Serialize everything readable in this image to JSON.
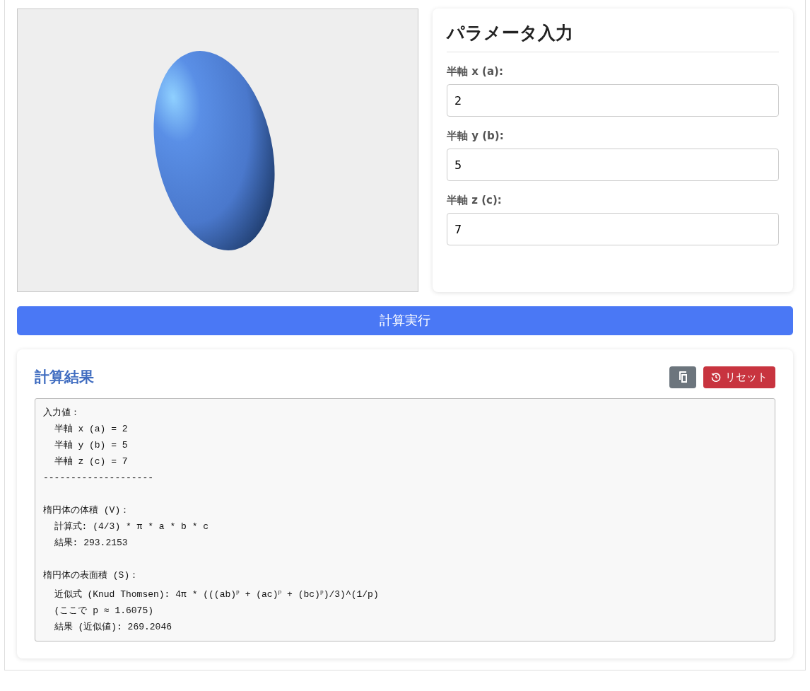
{
  "params": {
    "title": "パラメータ入力",
    "fields": [
      {
        "label": "半軸 x (a):",
        "value": "2"
      },
      {
        "label": "半軸 y (b):",
        "value": "5"
      },
      {
        "label": "半軸 z (c):",
        "value": "7"
      }
    ]
  },
  "calculate_button": "計算実行",
  "results": {
    "title": "計算結果",
    "reset_button": "リセット",
    "sections": [
      {
        "lines": [
          "入力値：",
          "  半軸 x (a) = 2",
          "  半軸 y (b) = 5",
          "  半軸 z (c) = 7",
          "--------------------"
        ]
      },
      {
        "lines": [
          "楕円体の体積 (V)：",
          "  計算式: (4/3) * π * a * b * c",
          "  結果: 293.2153"
        ]
      },
      {
        "lines": [
          "楕円体の表面積 (S)：",
          "  近似式 (Knud Thomsen): 4π * (((ab)$^{p}$ + (ac)$^{p}$ + (bc)$^{p}$)/3)^(1/p)",
          "  (ここで p ≈ 1.6075)",
          "  結果 (近似値): 269.2046"
        ]
      }
    ]
  }
}
